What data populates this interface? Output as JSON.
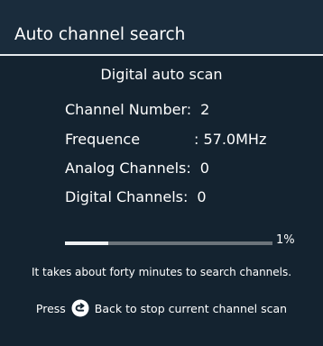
{
  "dialog": {
    "title": "Auto channel search",
    "subtitle": "Digital auto scan"
  },
  "info": {
    "channel_number_label": "Channel Number:",
    "channel_number_value": "2",
    "frequence_label": "Frequence",
    "frequence_value": ": 57.0MHz",
    "analog_label": "Analog Channels:",
    "analog_value": "0",
    "digital_label": "Digital Channels:",
    "digital_value": "0"
  },
  "progress": {
    "percent": 0.21,
    "label": "1%"
  },
  "note": "It takes about forty minutes to search channels.",
  "hint": {
    "prefix": "Press",
    "icon": "back-icon",
    "suffix": "Back to stop current channel scan"
  },
  "colors": {
    "background": "#142330",
    "title_bar": "#1a2c3c",
    "progress_fill": "#eef0f2",
    "progress_track": "#6c747b"
  }
}
